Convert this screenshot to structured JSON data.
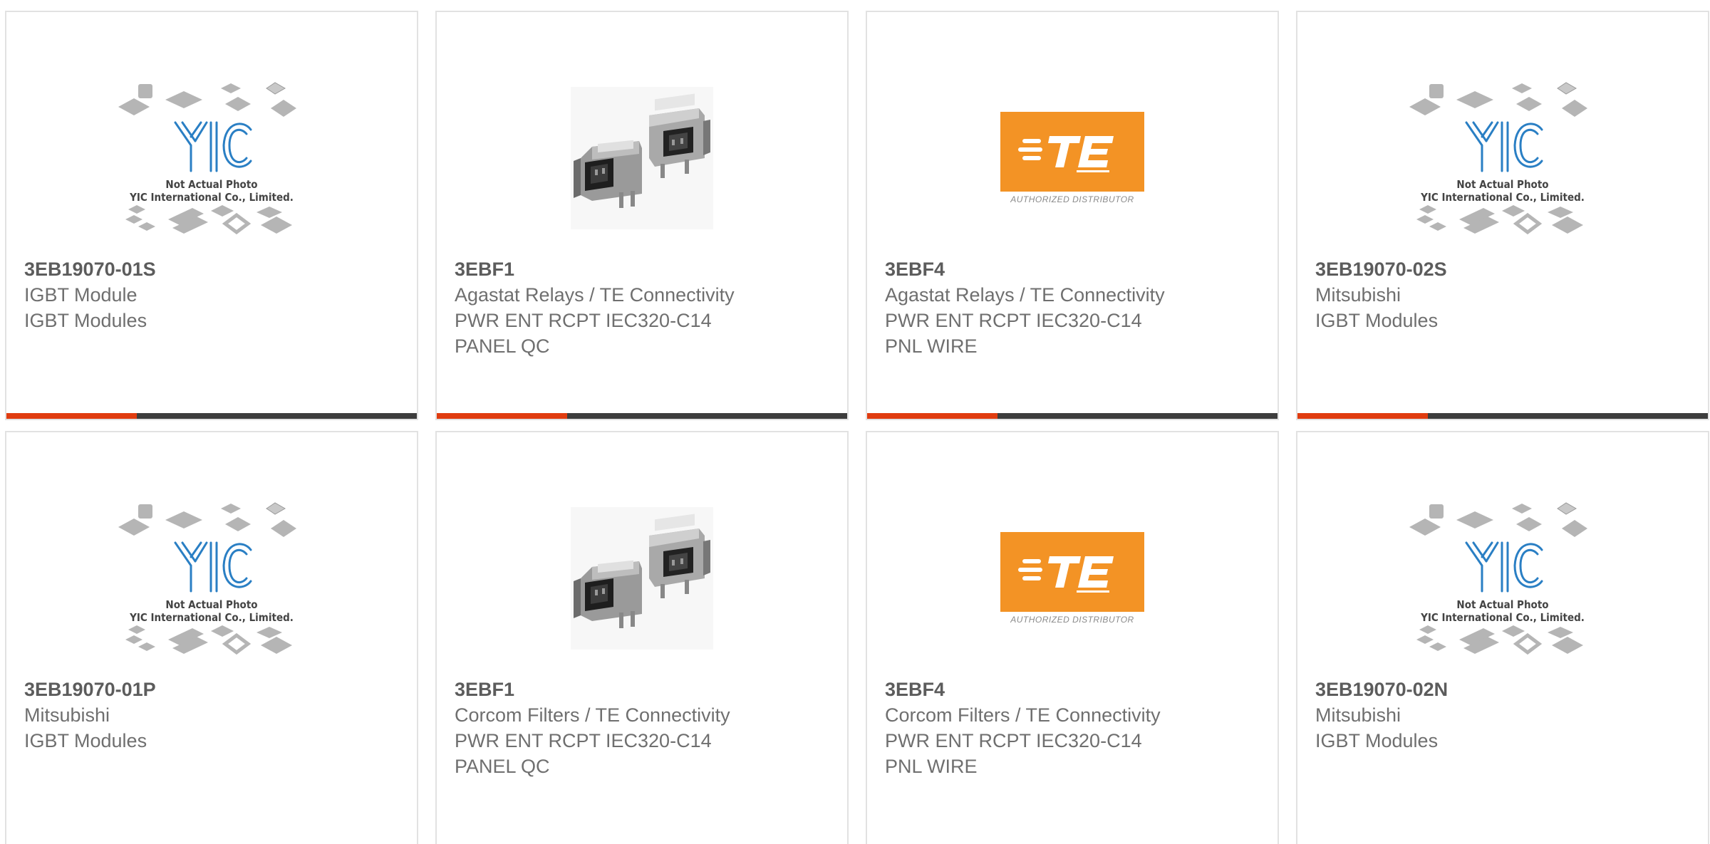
{
  "cards": [
    {
      "part": "3EB19070-01S",
      "lines": [
        "IGBT Module",
        "IGBT Modules"
      ],
      "image": "yic-placeholder",
      "image_text": [
        "Not Actual Photo",
        "YIC International Co., Limited."
      ]
    },
    {
      "part": "3EBF1",
      "lines": [
        "Agastat Relays / TE Connectivity",
        "PWR ENT RCPT IEC320-C14",
        "PANEL QC"
      ],
      "image": "power-entry-module-photo"
    },
    {
      "part": "3EBF4",
      "lines": [
        "Agastat Relays / TE Connectivity",
        "PWR ENT RCPT IEC320-C14",
        "PNL WIRE"
      ],
      "image": "te-logo",
      "image_text": [
        "AUTHORIZED DISTRIBUTOR"
      ]
    },
    {
      "part": "3EB19070-02S",
      "lines": [
        "Mitsubishi",
        "IGBT Modules"
      ],
      "image": "yic-placeholder",
      "image_text": [
        "Not Actual Photo",
        "YIC International Co., Limited."
      ]
    },
    {
      "part": "3EB19070-01P",
      "lines": [
        "Mitsubishi",
        "IGBT Modules"
      ],
      "image": "yic-placeholder",
      "image_text": [
        "Not Actual Photo",
        "YIC International Co., Limited."
      ]
    },
    {
      "part": "3EBF1",
      "lines": [
        "Corcom Filters / TE Connectivity",
        "PWR ENT RCPT IEC320-C14",
        "PANEL QC"
      ],
      "image": "power-entry-module-photo"
    },
    {
      "part": "3EBF4",
      "lines": [
        "Corcom Filters / TE Connectivity",
        "PWR ENT RCPT IEC320-C14",
        "PNL WIRE"
      ],
      "image": "te-logo",
      "image_text": [
        "AUTHORIZED DISTRIBUTOR"
      ]
    },
    {
      "part": "3EB19070-02N",
      "lines": [
        "Mitsubishi",
        "IGBT Modules"
      ],
      "image": "yic-placeholder",
      "image_text": [
        "Not Actual Photo",
        "YIC International Co., Limited."
      ]
    }
  ],
  "colors": {
    "accent": "#e03c10",
    "bar": "#3d3d3d",
    "te_orange": "#f39325",
    "yic_blue": "#2a7fc4",
    "text": "#6f6f6f"
  }
}
